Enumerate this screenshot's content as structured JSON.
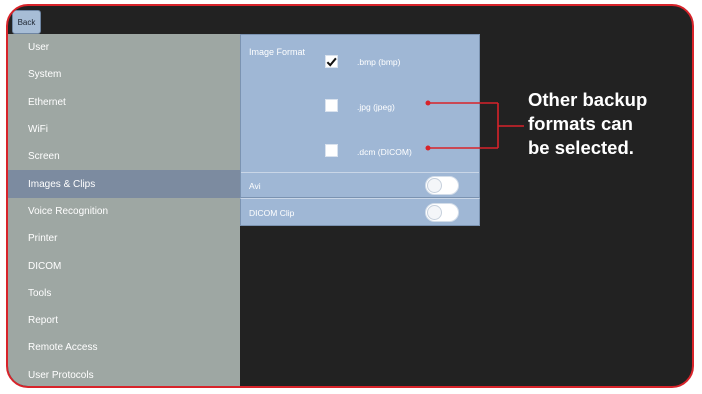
{
  "header": {
    "back_label": "Back"
  },
  "sidebar": {
    "items": [
      {
        "label": "User"
      },
      {
        "label": "System"
      },
      {
        "label": "Ethernet"
      },
      {
        "label": "WiFi"
      },
      {
        "label": "Screen"
      },
      {
        "label": "Images & Clips",
        "active": true
      },
      {
        "label": "Voice Recognition"
      },
      {
        "label": "Printer"
      },
      {
        "label": "DICOM"
      },
      {
        "label": "Tools"
      },
      {
        "label": "Report"
      },
      {
        "label": "Remote Access"
      },
      {
        "label": "User Protocols"
      }
    ]
  },
  "images_panel": {
    "image_format_label": "Image Format",
    "formats": [
      {
        "label": ".bmp (bmp)",
        "checked": true
      },
      {
        "label": ".jpg (jpeg)",
        "checked": false
      },
      {
        "label": ".dcm (DICOM)",
        "checked": false
      }
    ],
    "toggles": [
      {
        "label": "Avi",
        "on": false
      },
      {
        "label": "DICOM Clip",
        "on": false
      }
    ]
  },
  "annotation": {
    "lines": [
      "Other backup",
      "formats can",
      "be selected."
    ],
    "color": "#d8232a"
  },
  "colors": {
    "frame_border": "#d8232a",
    "background": "#222222",
    "sidebar": "#9ea7a3",
    "sidebar_active": "#7c8ba0",
    "panel": "#9fb7d5"
  }
}
